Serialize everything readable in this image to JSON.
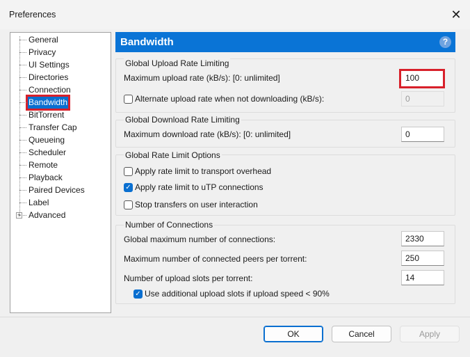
{
  "window": {
    "title": "Preferences"
  },
  "tree": [
    "General",
    "Privacy",
    "UI Settings",
    "Directories",
    "Connection",
    "Bandwidth",
    "BitTorrent",
    "Transfer Cap",
    "Queueing",
    "Scheduler",
    "Remote",
    "Playback",
    "Paired Devices",
    "Label",
    "Advanced"
  ],
  "selected": "Bandwidth",
  "header": "Bandwidth",
  "upload": {
    "title": "Global Upload Rate Limiting",
    "max_label": "Maximum upload rate (kB/s): [0: unlimited]",
    "max_value": "100",
    "alt_label": "Alternate upload rate when not downloading (kB/s):",
    "alt_value": "0",
    "alt_checked": false
  },
  "download": {
    "title": "Global Download Rate Limiting",
    "max_label": "Maximum download rate (kB/s): [0: unlimited]",
    "max_value": "0"
  },
  "options": {
    "title": "Global Rate Limit Options",
    "overhead": "Apply rate limit to transport overhead",
    "utp": "Apply rate limit to uTP connections",
    "stop": "Stop transfers on user interaction"
  },
  "connections": {
    "title": "Number of Connections",
    "global_label": "Global maximum number of connections:",
    "global_value": "2330",
    "peers_label": "Maximum number of connected peers per torrent:",
    "peers_value": "250",
    "slots_label": "Number of upload slots per torrent:",
    "slots_value": "14",
    "extra": "Use additional upload slots if upload speed < 90%"
  },
  "buttons": {
    "ok": "OK",
    "cancel": "Cancel",
    "apply": "Apply"
  }
}
